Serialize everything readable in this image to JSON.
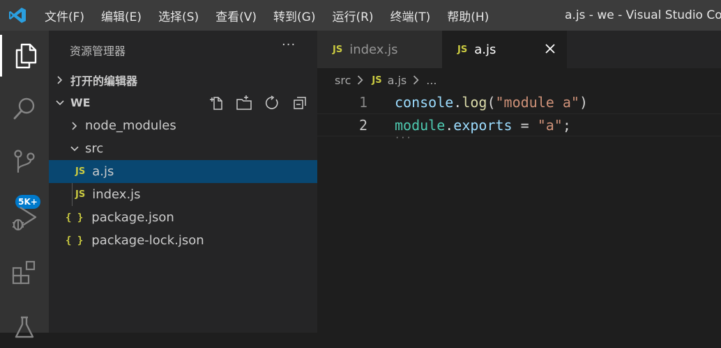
{
  "titlebar": {
    "menu": [
      "文件(F)",
      "编辑(E)",
      "选择(S)",
      "查看(V)",
      "转到(G)",
      "运行(R)",
      "终端(T)",
      "帮助(H)"
    ],
    "window_title": "a.js - we - Visual Studio Code"
  },
  "activitybar": {
    "icons": [
      "explorer-icon",
      "search-icon",
      "source-control-icon",
      "run-debug-icon",
      "extensions-icon",
      "testing-icon"
    ],
    "scm_badge": "5K+",
    "badge_color": "#007acc"
  },
  "sidebar": {
    "title": "资源管理器",
    "more": "···",
    "open_editors": "打开的编辑器",
    "workspace": "WE",
    "tree": [
      {
        "name": "node_modules",
        "type": "folder"
      },
      {
        "name": "src",
        "type": "folder"
      },
      {
        "name": "a.js",
        "type": "js",
        "badge": "JS"
      },
      {
        "name": "index.js",
        "type": "js",
        "badge": "JS"
      },
      {
        "name": "package.json",
        "type": "json",
        "badge": "{ }"
      },
      {
        "name": "package-lock.json",
        "type": "json",
        "badge": "{ }"
      }
    ]
  },
  "tabs": [
    {
      "label": "index.js",
      "badge": "JS",
      "active": false
    },
    {
      "label": "a.js",
      "badge": "JS",
      "active": true
    }
  ],
  "breadcrumb": {
    "folder": "src",
    "file": "a.js",
    "file_badge": "JS",
    "tail": "..."
  },
  "code": {
    "lines": [
      {
        "number": "1",
        "tokens": [
          {
            "t": "console",
            "c": "tk-ident"
          },
          {
            "t": ".",
            "c": "tk-punc"
          },
          {
            "t": "log",
            "c": "tk-fn"
          },
          {
            "t": "(",
            "c": "tk-punc"
          },
          {
            "t": "\"module a\"",
            "c": "tk-str"
          },
          {
            "t": ")",
            "c": "tk-punc"
          }
        ]
      },
      {
        "number": "2",
        "tokens": [
          {
            "t": "module",
            "c": "tk-obj"
          },
          {
            "t": ".",
            "c": "tk-punc"
          },
          {
            "t": "exports",
            "c": "tk-ident"
          },
          {
            "t": " = ",
            "c": "tk-punc"
          },
          {
            "t": "\"a\"",
            "c": "tk-str"
          },
          {
            "t": ";",
            "c": "tk-punc"
          }
        ]
      }
    ]
  },
  "colors": {
    "selection": "#094771",
    "js_badge": "#cbcb41"
  }
}
